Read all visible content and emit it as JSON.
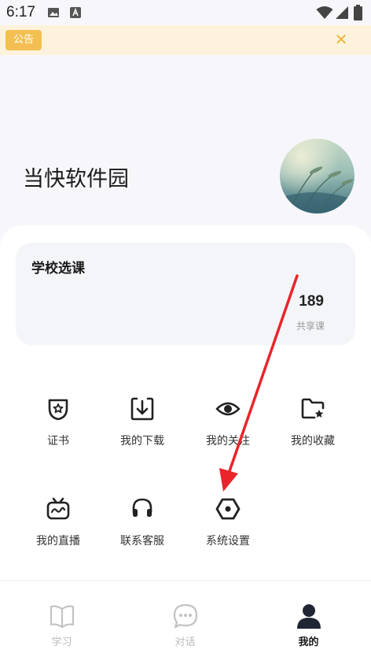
{
  "status_bar": {
    "time": "6:17",
    "icons": [
      "image-icon",
      "text-a-icon",
      "wifi-icon",
      "cellular-signal-icon",
      "battery-icon"
    ]
  },
  "notice": {
    "badge_label": "公告",
    "close_glyph": "✕"
  },
  "profile": {
    "name": "当快软件园"
  },
  "course_card": {
    "title": "学校选课",
    "count": "189",
    "count_label": "共享课"
  },
  "menu_items": [
    {
      "label": "证书",
      "icon": "certificate-icon"
    },
    {
      "label": "我的下载",
      "icon": "download-icon"
    },
    {
      "label": "我的关注",
      "icon": "eye-icon"
    },
    {
      "label": "我的收藏",
      "icon": "folder-star-icon"
    },
    {
      "label": "我的直播",
      "icon": "tv-live-icon"
    },
    {
      "label": "联系客服",
      "icon": "headset-icon"
    },
    {
      "label": "系统设置",
      "icon": "hexagon-settings-icon"
    }
  ],
  "tabs": [
    {
      "label": "学习",
      "icon": "book-icon",
      "active": false
    },
    {
      "label": "对话",
      "icon": "chat-bubble-icon",
      "active": false
    },
    {
      "label": "我的",
      "icon": "person-icon",
      "active": true
    }
  ],
  "colors": {
    "notice_bg": "#fdf3dc",
    "notice_badge": "#f3bf52",
    "annotation_arrow": "#e8252b"
  }
}
